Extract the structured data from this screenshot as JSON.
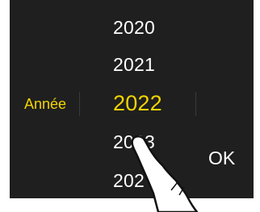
{
  "picker": {
    "field_label": "Année",
    "years": [
      {
        "label": "2020",
        "selected": false
      },
      {
        "label": "2021",
        "selected": false
      },
      {
        "label": "2022",
        "selected": true
      },
      {
        "label": "2023",
        "selected": false
      },
      {
        "label": "202",
        "selected": false
      }
    ],
    "ok_label": "OK"
  },
  "colors": {
    "background": "#1f1f1f",
    "text": "#ffffff",
    "accent": "#f2d400",
    "divider": "#3a3a3a"
  },
  "icons": {
    "pointer": "tapping-hand-icon"
  }
}
